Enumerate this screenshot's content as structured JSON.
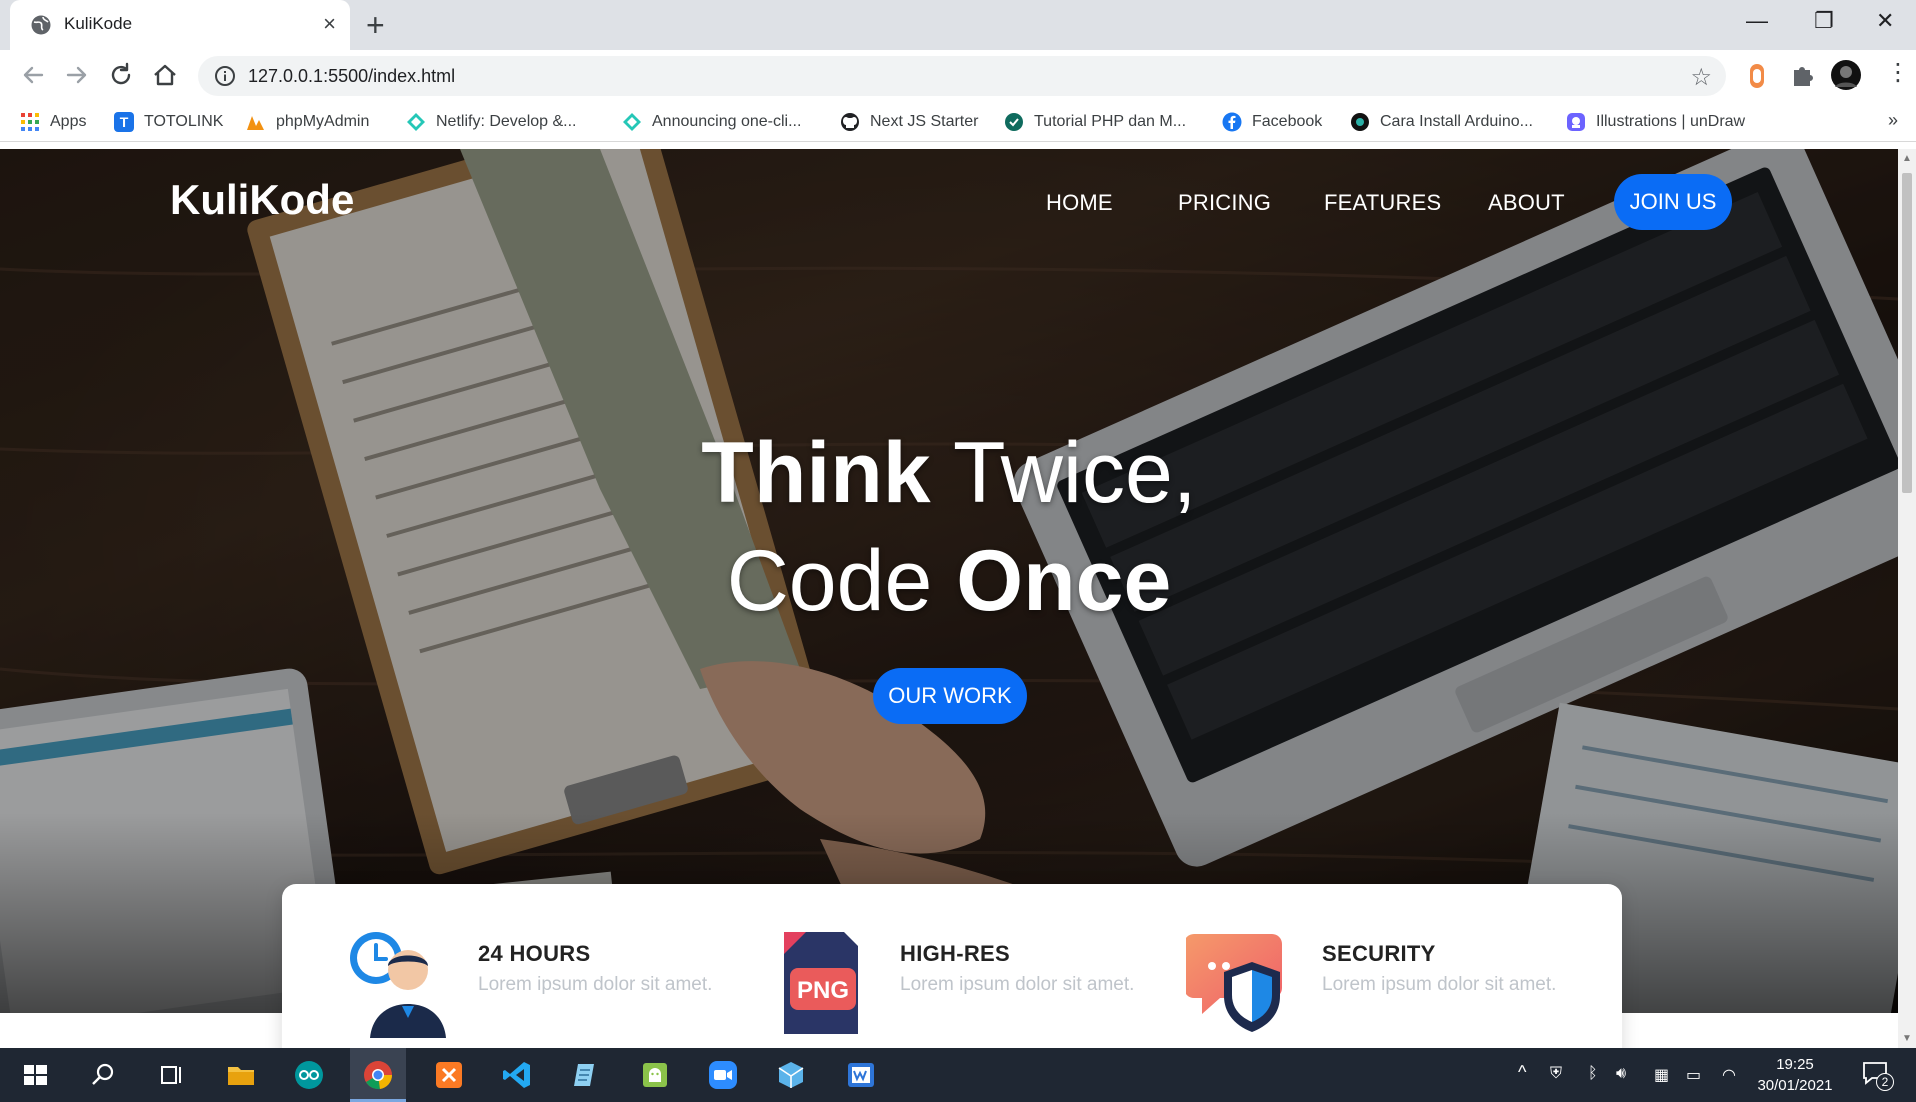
{
  "browser": {
    "tab_title": "KuliKode",
    "tab_close": "×",
    "new_tab": "+",
    "url": "127.0.0.1:5500/index.html",
    "window_controls": {
      "minimize": "—",
      "restore": "❐",
      "close": "✕"
    },
    "bookmarks": [
      {
        "label": "Apps",
        "icon": "apps-grid-icon",
        "color": "#ea4335"
      },
      {
        "label": "TOTOLINK",
        "icon": "totolink-icon",
        "color": "#1a73e8"
      },
      {
        "label": "phpMyAdmin",
        "icon": "phpmyadmin-icon",
        "color": "#f29111"
      },
      {
        "label": "Netlify: Develop &...",
        "icon": "netlify-icon",
        "color": "#25c7b7"
      },
      {
        "label": "Announcing one-cli...",
        "icon": "netlify-icon",
        "color": "#25c7b7"
      },
      {
        "label": "Next JS Starter",
        "icon": "github-icon",
        "color": "#202124"
      },
      {
        "label": "Tutorial PHP dan M...",
        "icon": "site-icon",
        "color": "#0f6b5e"
      },
      {
        "label": "Facebook",
        "icon": "facebook-icon",
        "color": "#1877f2"
      },
      {
        "label": "Cara Install Arduino...",
        "icon": "site-icon",
        "color": "#111111"
      },
      {
        "label": "Illustrations | unDraw",
        "icon": "undraw-icon",
        "color": "#6c63ff"
      }
    ],
    "bookmarks_more": "»"
  },
  "site": {
    "brand": "KuliKode",
    "nav": [
      {
        "label": "HOME"
      },
      {
        "label": "PRICING"
      },
      {
        "label": "FEATURES"
      },
      {
        "label": "ABOUT"
      }
    ],
    "join_label": "JOIN US",
    "headline": {
      "line1_bold": "Think",
      "line1_thin": " Twice,",
      "line2_thin": "Code ",
      "line2_bold": "Once"
    },
    "cta_label": "OUR WORK",
    "features": [
      {
        "title": "24 HOURS",
        "desc": "Lorem ipsum dolor sit amet.",
        "icon": "customer-support-icon"
      },
      {
        "title": "HIGH-RES",
        "desc": "Lorem ipsum dolor sit amet.",
        "icon": "png-file-icon",
        "badge": "PNG"
      },
      {
        "title": "SECURITY",
        "desc": "Lorem ipsum dolor sit amet.",
        "icon": "security-shield-icon"
      }
    ]
  },
  "taskbar": {
    "time": "19:25",
    "date": "30/01/2021",
    "notification_count": "2"
  },
  "colors": {
    "accent": "#0a6cf5",
    "tabstrip": "#dee1e6",
    "taskbar": "#1f2733"
  }
}
